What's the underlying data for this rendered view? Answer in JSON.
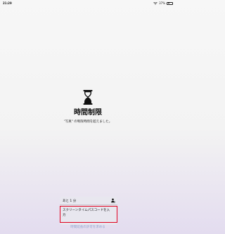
{
  "status_bar": {
    "time": "21:29",
    "battery_text": "37%",
    "battery_level": 0.37
  },
  "screen": {
    "title": "時間制限",
    "subtitle": "\"写真\" の制限時間を超えました。"
  },
  "sheet": {
    "one_more_minute": "あと 1 分",
    "enter_passcode": "スクリーンタイムパスコードを入力",
    "ask_for_more_time": "時間延長の許可を求める"
  },
  "icons": {
    "hourglass": "hourglass-icon",
    "person": "person-settings-icon",
    "wifi": "wifi-icon",
    "battery": "battery-icon"
  }
}
